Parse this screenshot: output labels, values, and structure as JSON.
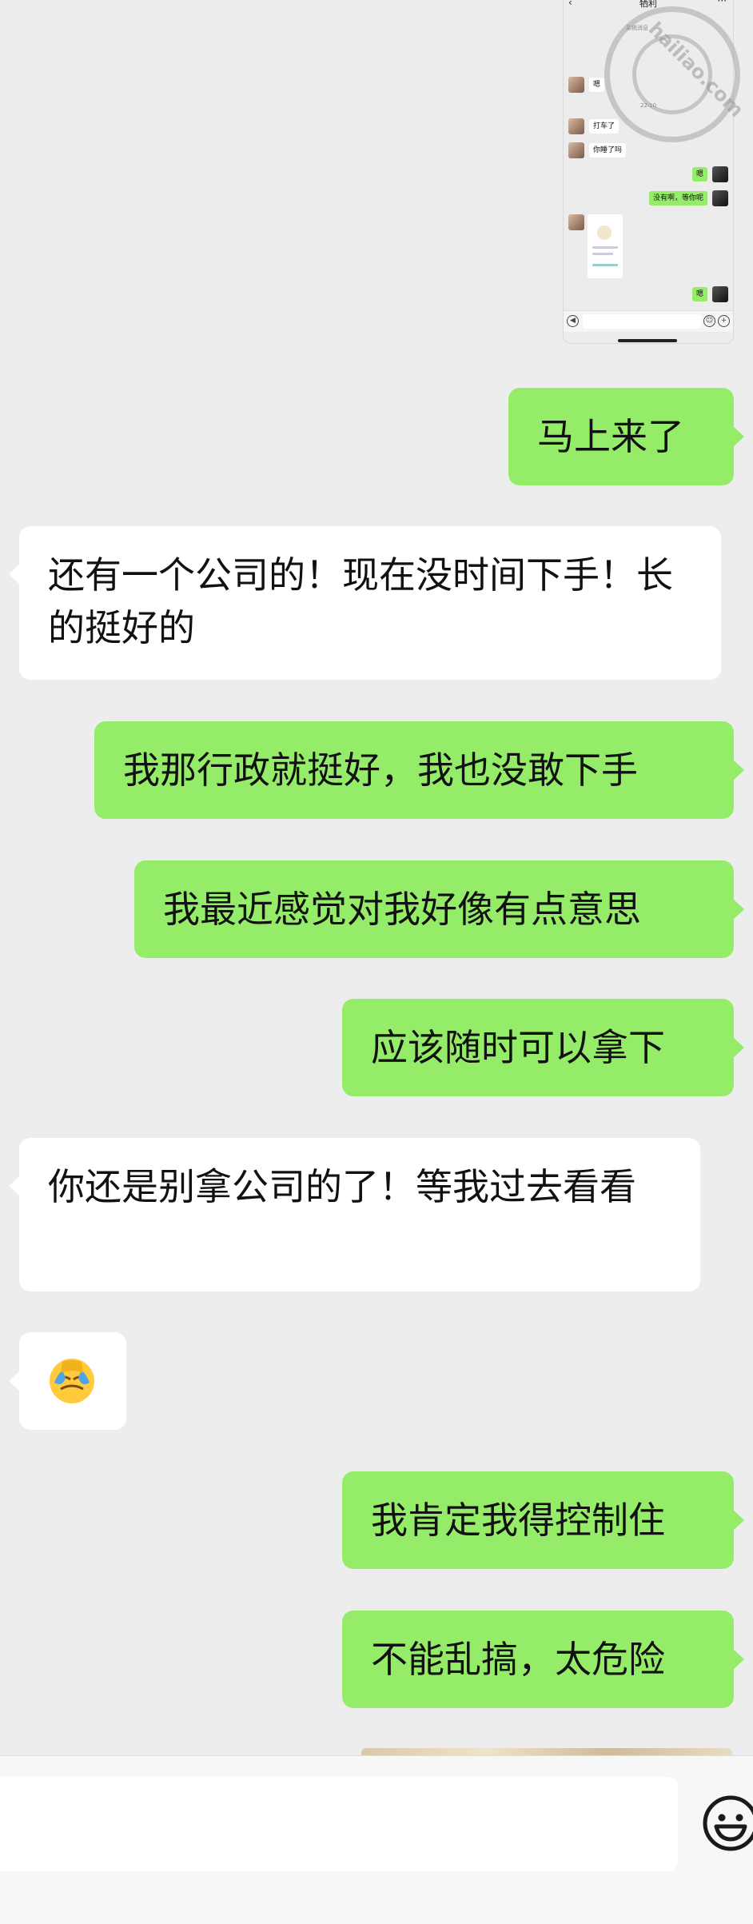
{
  "thumbnail": {
    "title": "牺利",
    "back": "‹",
    "more": "···",
    "subtitle": "系统消息",
    "time": "22:10",
    "messages": [
      {
        "text": "嗯",
        "dir": "in"
      },
      {
        "text": "打车了",
        "dir": "in"
      },
      {
        "text": "你睡了吗",
        "dir": "in"
      },
      {
        "text": "嗯",
        "dir": "out"
      },
      {
        "text": "没有啊，等你呢",
        "dir": "out"
      },
      {
        "text": "嗯",
        "dir": "out"
      }
    ]
  },
  "watermark": {
    "text": "hailiao.com"
  },
  "messages": [
    {
      "text": "马上来了",
      "dir": "out"
    },
    {
      "text": "还有一个公司的！现在没时间下手！长的挺好的",
      "dir": "in"
    },
    {
      "text": "我那行政就挺好，我也没敢下手",
      "dir": "out"
    },
    {
      "text": "我最近感觉对我好像有点意思",
      "dir": "out"
    },
    {
      "text": "应该随时可以拿下",
      "dir": "out"
    },
    {
      "text": "你还是别拿公司的了！等我过去看看",
      "dir": "in"
    },
    {
      "text": "face-palm-emoji",
      "dir": "in"
    },
    {
      "text": "我肯定我得控制住",
      "dir": "out"
    },
    {
      "text": "不能乱搞，太危险",
      "dir": "out"
    }
  ],
  "input_bar": {
    "emoji_icon": "smiley-icon"
  },
  "colors": {
    "outgoing": "#95ec69",
    "incoming": "#ffffff",
    "background": "#ededed"
  }
}
